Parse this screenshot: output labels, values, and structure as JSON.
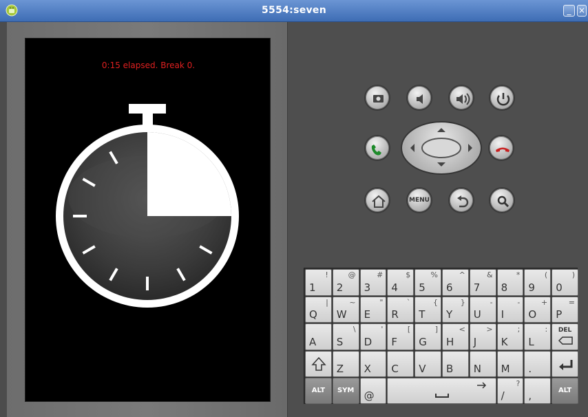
{
  "window": {
    "title": "5554:seven",
    "minimize_label": "_",
    "close_label": "×"
  },
  "app": {
    "status_text": "0:15 elapsed. Break 0.",
    "status_color": "#e02020",
    "elapsed_fraction": 0.25
  },
  "controls": {
    "camera": "camera-icon",
    "volume_down": "volume-down-icon",
    "volume_up": "volume-up-icon",
    "power": "power-icon",
    "call": "call-icon",
    "end_call": "end-call-icon",
    "home": "home-icon",
    "menu_label": "MENU",
    "back": "back-icon",
    "search": "search-icon"
  },
  "keyboard": {
    "row1": [
      {
        "main": "1",
        "alt": "!"
      },
      {
        "main": "2",
        "alt": "@"
      },
      {
        "main": "3",
        "alt": "#"
      },
      {
        "main": "4",
        "alt": "$"
      },
      {
        "main": "5",
        "alt": "%"
      },
      {
        "main": "6",
        "alt": "^"
      },
      {
        "main": "7",
        "alt": "&"
      },
      {
        "main": "8",
        "alt": "*"
      },
      {
        "main": "9",
        "alt": "("
      },
      {
        "main": "0",
        "alt": ")"
      }
    ],
    "row2": [
      {
        "main": "Q",
        "alt": "|"
      },
      {
        "main": "W",
        "alt": "~"
      },
      {
        "main": "E",
        "alt": "\""
      },
      {
        "main": "R",
        "alt": "`"
      },
      {
        "main": "T",
        "alt": "{"
      },
      {
        "main": "Y",
        "alt": "}"
      },
      {
        "main": "U",
        "alt": "-"
      },
      {
        "main": "I",
        "alt": "-"
      },
      {
        "main": "O",
        "alt": "+"
      },
      {
        "main": "P",
        "alt": "="
      }
    ],
    "row3": [
      {
        "main": "A",
        "alt": ""
      },
      {
        "main": "S",
        "alt": "\\"
      },
      {
        "main": "D",
        "alt": "'"
      },
      {
        "main": "F",
        "alt": "["
      },
      {
        "main": "G",
        "alt": "]"
      },
      {
        "main": "H",
        "alt": "<"
      },
      {
        "main": "J",
        "alt": ">"
      },
      {
        "main": "K",
        "alt": ";"
      },
      {
        "main": "L",
        "alt": ":"
      }
    ],
    "del_label": "DEL",
    "row4": [
      {
        "main": "Z",
        "alt": ""
      },
      {
        "main": "X",
        "alt": ""
      },
      {
        "main": "C",
        "alt": ""
      },
      {
        "main": "V",
        "alt": ""
      },
      {
        "main": "B",
        "alt": ""
      },
      {
        "main": "N",
        "alt": ""
      },
      {
        "main": "M",
        "alt": ""
      },
      {
        "main": ".",
        "alt": ""
      }
    ],
    "alt_label": "ALT",
    "sym_label": "SYM",
    "at_label": "@",
    "slash_main": "/",
    "slash_alt": "?",
    "comma_main": ","
  }
}
